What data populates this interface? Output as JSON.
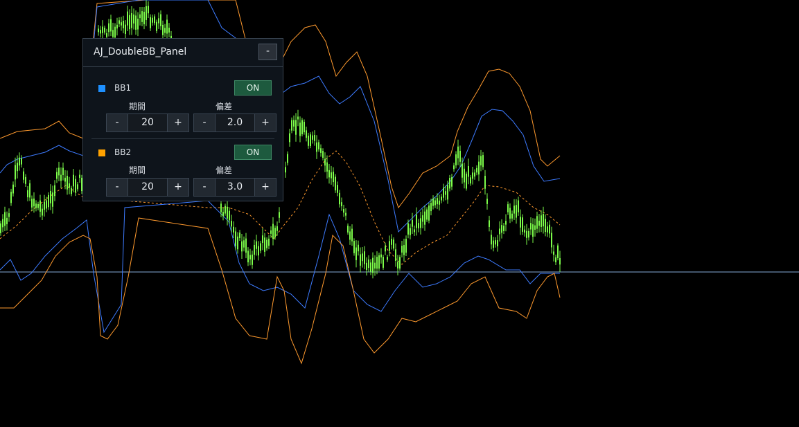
{
  "colors": {
    "background": "#000000",
    "candles": "#7CFC4A",
    "bb1_band": "#3d7bff",
    "bb2_band": "#ff9a2e",
    "middle_line": "#ff9a2e",
    "price_line": "#9ec8ff",
    "bb1_swatch": "#1e90ff",
    "bb2_swatch": "#ffa200",
    "on_button": "#1d5a3e"
  },
  "panel": {
    "title": "AJ_DoubleBB_Panel",
    "minimize_label": "-",
    "bb1": {
      "label": "BB1",
      "toggle_label": "ON",
      "period_label": "期間",
      "period_value": "20",
      "deviation_label": "偏差",
      "deviation_value": "2.0",
      "minus_label": "-",
      "plus_label": "+"
    },
    "bb2": {
      "label": "BB2",
      "toggle_label": "ON",
      "period_label": "期間",
      "period_value": "20",
      "deviation_label": "偏差",
      "deviation_value": "3.0",
      "minus_label": "-",
      "plus_label": "+"
    }
  }
}
